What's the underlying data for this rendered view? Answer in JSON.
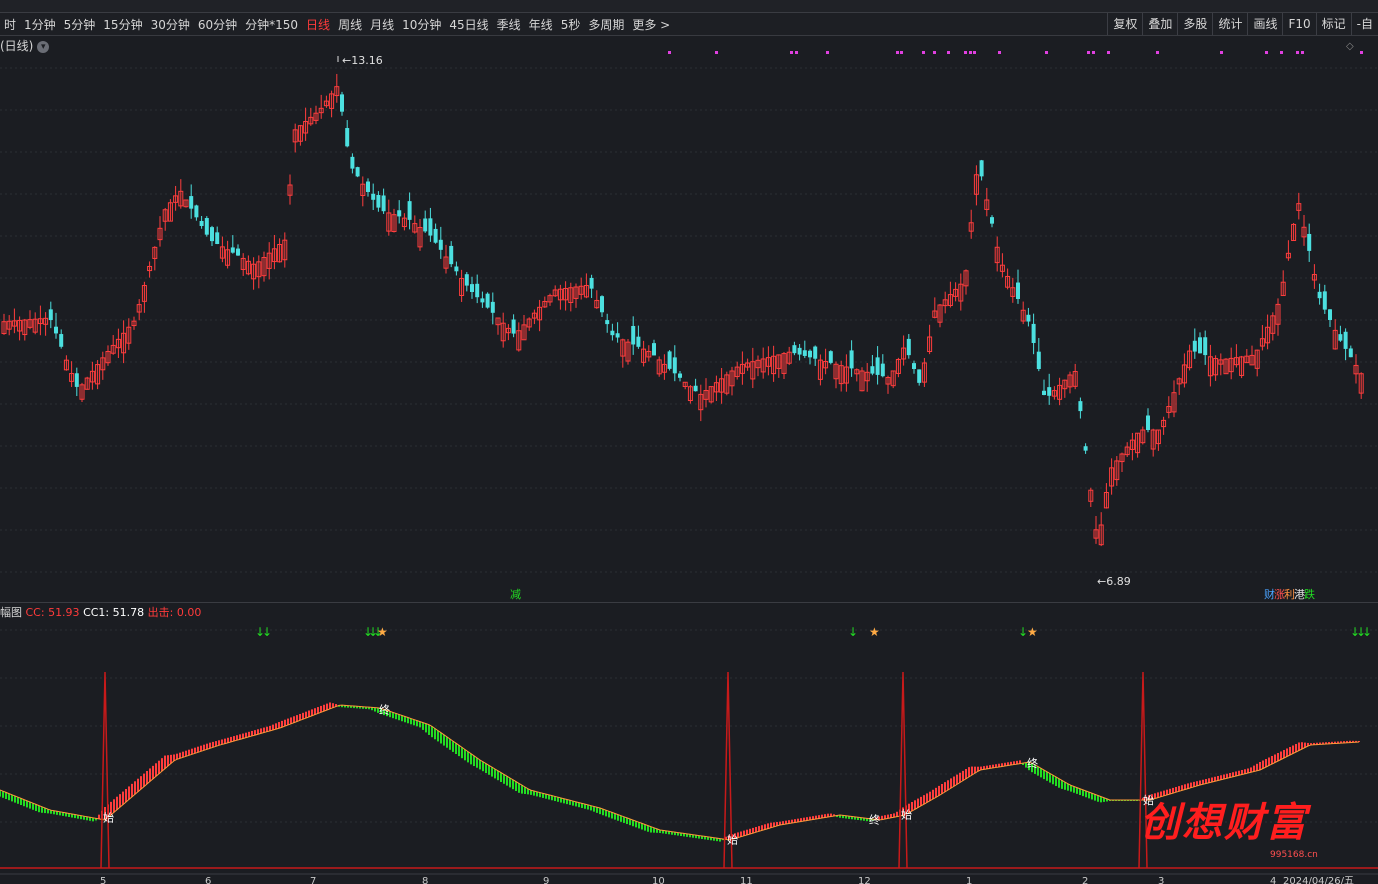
{
  "top_strip": [
    "...",
    "...",
    "...",
    "...",
    "...",
    "...",
    "..."
  ],
  "toolbar": {
    "periods": [
      "时",
      "1分钟",
      "5分钟",
      "15分钟",
      "30分钟",
      "60分钟",
      "分钟*150",
      "日线",
      "周线",
      "月线",
      "10分钟",
      "45日线",
      "季线",
      "年线",
      "5秒",
      "多周期",
      "更多 >"
    ],
    "active_period": "日线",
    "tools": [
      "复权",
      "叠加",
      "多股",
      "统计",
      "画线",
      "F10",
      "标记",
      "-自"
    ]
  },
  "main_chart": {
    "title": "(日线)",
    "high_label": "13.16",
    "low_label": "6.89",
    "event_label_mid": "减",
    "event_labels_right": [
      "财",
      "涨",
      "利",
      "港",
      "跌"
    ]
  },
  "indicator": {
    "name": "幅图",
    "cc_label": "CC: 51.93",
    "cc1_label": "CC1: 51.78",
    "out_label": "出击: 0.00",
    "markers_start": "始",
    "markers_end": "终"
  },
  "x_axis": {
    "labels": [
      "5",
      "6",
      "7",
      "8",
      "9",
      "10",
      "11",
      "12",
      "1",
      "2",
      "3",
      "4",
      "2024/04/26/五"
    ]
  },
  "watermark": {
    "text": "创想财富",
    "url": "995168.cn"
  },
  "colors": {
    "up": "#ff3d3d",
    "down": "#4ce0e0",
    "green": "#22dd22",
    "magenta": "#e040e0",
    "active": "#ff3b3b"
  }
}
